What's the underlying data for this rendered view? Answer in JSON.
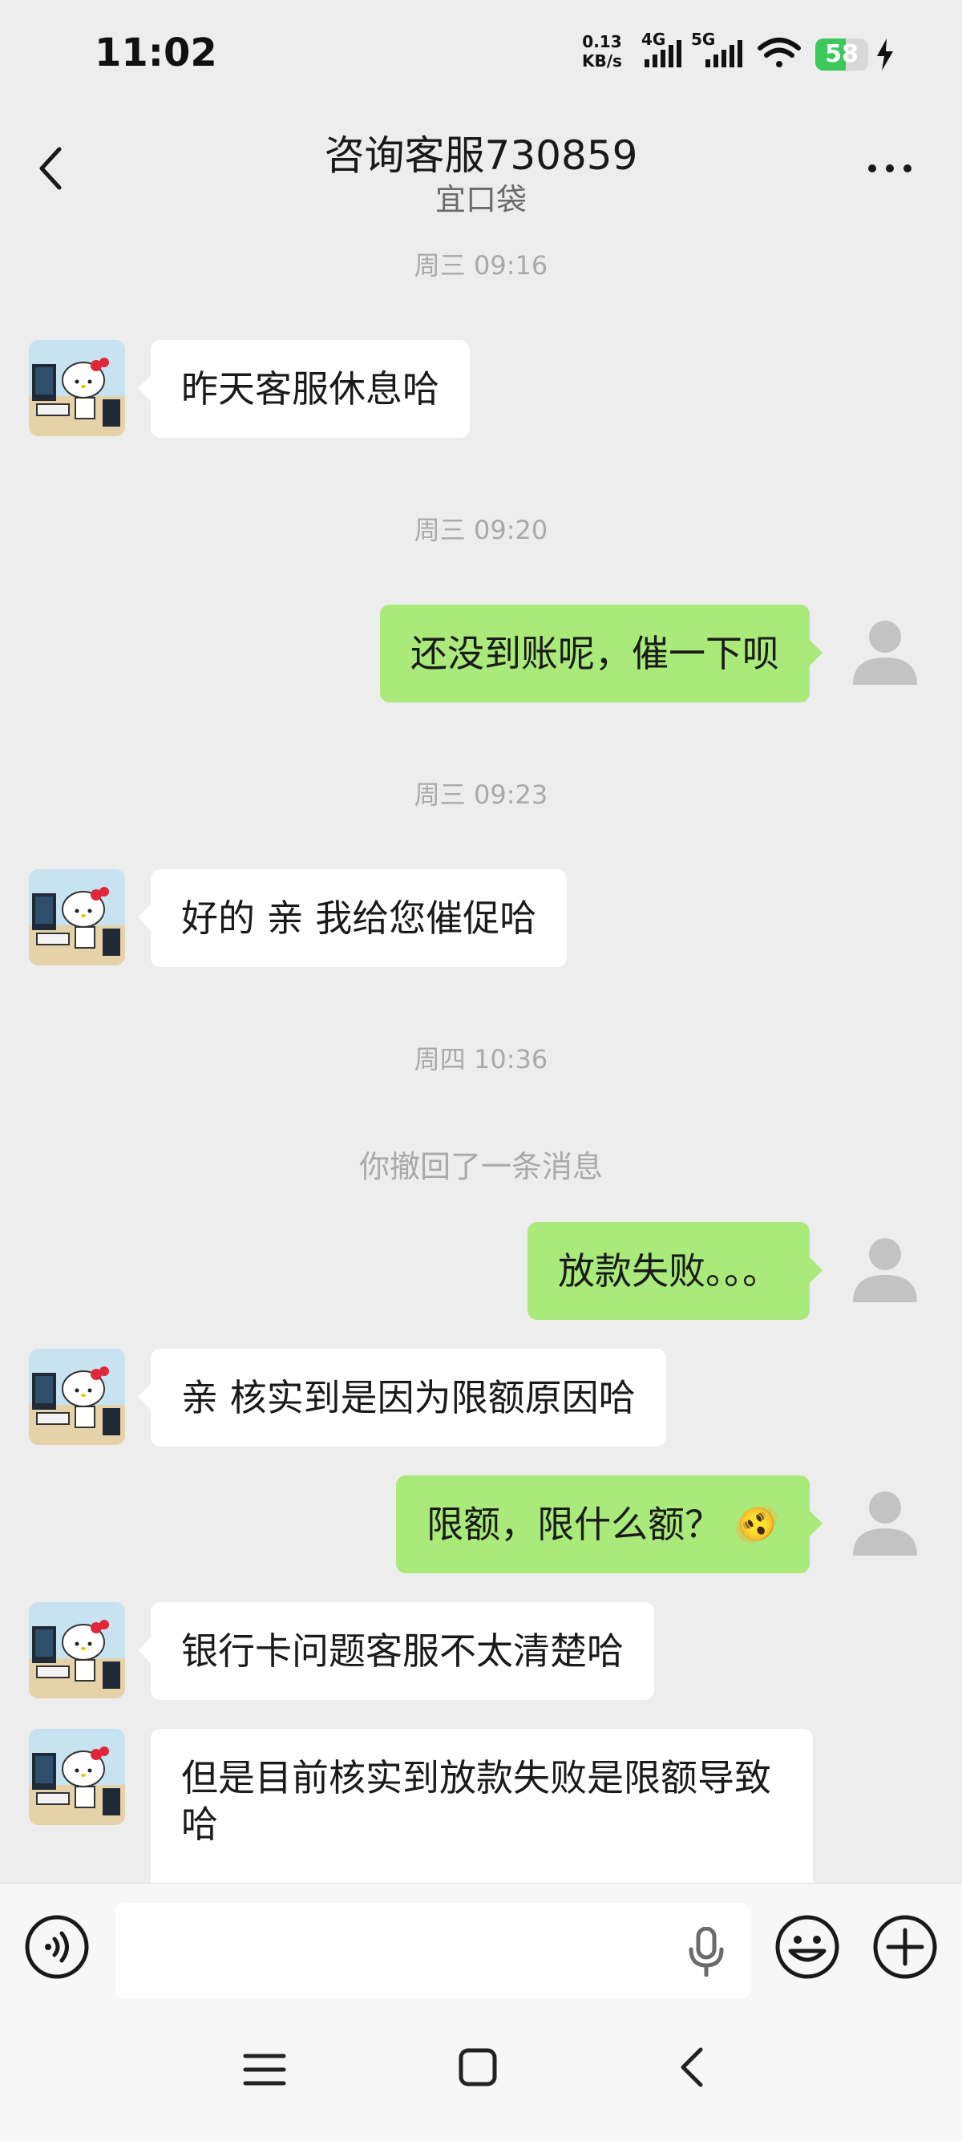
{
  "status_bar": {
    "time": "11:02",
    "net_speed_value": "0.13",
    "net_speed_unit": "KB/s",
    "sim1": "4G",
    "sim2": "5G",
    "battery": "58",
    "battery_level": 0.58
  },
  "header": {
    "title": "咨询客服730859",
    "subtitle": "宜口袋"
  },
  "messages": {
    "ts1": "周三 09:16",
    "m1": "昨天客服休息哈",
    "ts2": "周三 09:20",
    "m2": "还没到账呢，催一下呗",
    "ts3": "周三 09:23",
    "m3": "好的 亲 我给您催促哈",
    "ts4": "周四 10:36",
    "recall": "你撤回了一条消息",
    "m4": "放款失败。。。",
    "m5": "亲 核实到是因为限额原因哈",
    "m6": "限额，限什么额？",
    "m6_emoji": "🫨",
    "m7": "银行卡问题客服不太清楚哈",
    "m8": "但是目前核实到放款失败是限额导致哈"
  },
  "icons": {
    "back": "chevron-left-icon",
    "more": "more-dots-icon",
    "voice": "voice-icon",
    "mic": "microphone-icon",
    "emoji": "emoji-icon",
    "plus": "plus-icon",
    "agent_avatar": "hello-kitty-avatar",
    "user_avatar": "default-user-avatar"
  },
  "colors": {
    "outgoing_bubble": "#a9ea7a",
    "incoming_bubble": "#ffffff",
    "background": "#ededed",
    "battery": "#3ac95a"
  }
}
